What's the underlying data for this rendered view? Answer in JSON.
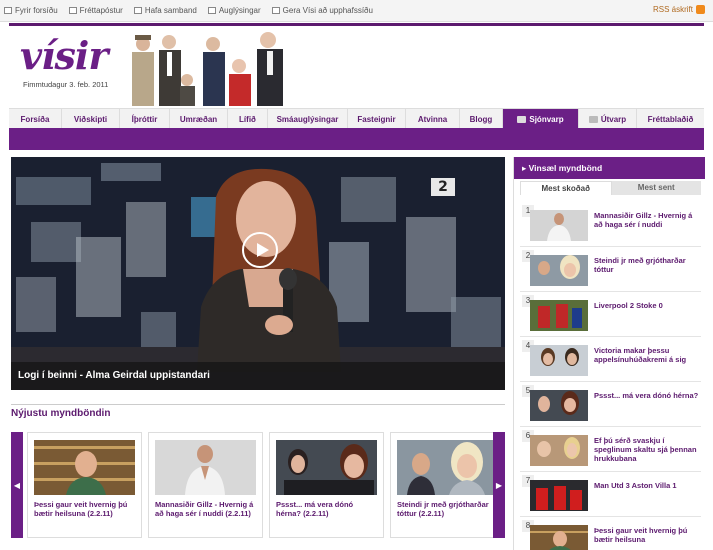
{
  "topbar": {
    "links": [
      {
        "label": "Fyrir forsíðu",
        "icon": "home-icon"
      },
      {
        "label": "Fréttapóstur",
        "icon": "mail-icon"
      },
      {
        "label": "Hafa samband",
        "icon": "contact-icon"
      },
      {
        "label": "Auglýsingar",
        "icon": "megaphone-icon"
      },
      {
        "label": "Gera Vísi að upphafssíðu",
        "icon": "star-icon"
      }
    ],
    "rss_label": "RSS áskrift",
    "rss_icon": "rss-icon"
  },
  "header": {
    "logo": "vísir",
    "date": "Fimmtudagur 3. feb. 2011"
  },
  "nav": {
    "items": [
      "Forsíða",
      "Viðskipti",
      "Íþróttir",
      "Umræðan",
      "Lífið",
      "Smáauglýsingar",
      "Fasteignir",
      "Atvinna",
      "Blogg",
      "Sjónvarp",
      "Útvarp",
      "Fréttablaðið"
    ],
    "active_label": "Sjónvarp"
  },
  "player": {
    "caption": "Logi í beinni - Alma Geirdal uppistandari",
    "channel_logo": "2"
  },
  "section": {
    "title": "Nýjustu myndböndin"
  },
  "carousel": [
    {
      "title": "Þessi gaur veit hvernig þú bætir heilsuna (2.2.11)"
    },
    {
      "title": "Mannasiðir Gillz - Hvernig á að haga sér í nuddi (2.2.11)"
    },
    {
      "title": "Pssst... má vera dónó hérna? (2.2.11)"
    },
    {
      "title": "Steindi jr með grjótharðar tóttur (2.2.11)"
    }
  ],
  "sidebar": {
    "title": "Vinsæl myndbönd",
    "tabs": [
      "Mest skoðað",
      "Mest sent"
    ],
    "items": [
      {
        "num": "1",
        "title": "Mannasiðir Gillz - Hvernig á að haga sér í nuddi"
      },
      {
        "num": "2",
        "title": "Steindi jr með grjótharðar tóttur"
      },
      {
        "num": "3",
        "title": "Liverpool 2 Stoke 0"
      },
      {
        "num": "4",
        "title": "Victoria makar þessu appelsínuhúðakremi á sig"
      },
      {
        "num": "5",
        "title": "Pssst... má vera dónó hérna?"
      },
      {
        "num": "6",
        "title": "Ef þú sérð svaskju í speglinum skaltu sjá þennan hrukkubana"
      },
      {
        "num": "7",
        "title": "Man Utd 3 Aston Villa 1"
      },
      {
        "num": "8",
        "title": "Þessi gaur veit hvernig þú bætir heilsuna"
      }
    ]
  },
  "colors": {
    "brand_purple": "#6b1f86",
    "rss_orange": "#f08a1c"
  }
}
